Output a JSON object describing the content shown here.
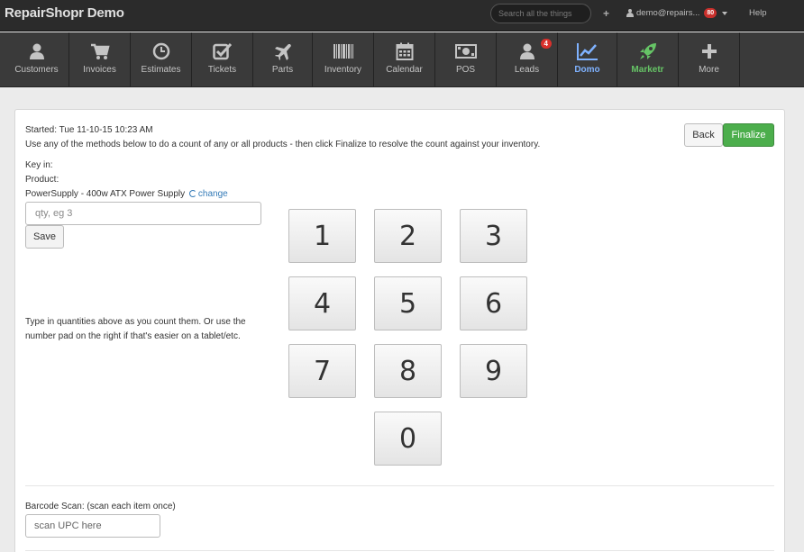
{
  "app": {
    "title": "RepairShopr Demo"
  },
  "header": {
    "search_placeholder": "Search all the things",
    "plus_label": "+",
    "user_label": "demo@repairs...",
    "user_badge": "80",
    "help_label": "Help"
  },
  "nav": {
    "items": [
      {
        "label": "Customers",
        "icon": "user-icon"
      },
      {
        "label": "Invoices",
        "icon": "cart-icon"
      },
      {
        "label": "Estimates",
        "icon": "clock-icon"
      },
      {
        "label": "Tickets",
        "icon": "checkbox-icon"
      },
      {
        "label": "Parts",
        "icon": "plane-icon"
      },
      {
        "label": "Inventory",
        "icon": "barcode-icon"
      },
      {
        "label": "Calendar",
        "icon": "calendar-icon"
      },
      {
        "label": "POS",
        "icon": "money-icon"
      },
      {
        "label": "Leads",
        "icon": "user-icon",
        "badge": "4"
      },
      {
        "label": "Domo",
        "icon": "chart-icon",
        "active": true
      },
      {
        "label": "Marketr",
        "icon": "rocket-icon"
      },
      {
        "label": "More",
        "icon": "plus-icon"
      }
    ],
    "active_color": "#7fb2ff",
    "marketr_color": "#66c466"
  },
  "count": {
    "started": "Started: Tue 11-10-15 10:23 AM",
    "instructions": "Use any of the methods below to do a count of any or all products - then click Finalize to resolve the count against your inventory.",
    "key_in_label": "Key in:",
    "product_label": "Product:",
    "product_name": "PowerSupply - 400w ATX Power Supply",
    "change_label": "change",
    "qty_placeholder": "qty, eg 3",
    "save_label": "Save",
    "help_text": "Type in quantities above as you count them. Or use the number pad on the right if that's easier on a tablet/etc.",
    "back_label": "Back",
    "finalize_label": "Finalize",
    "finalize_color": "#4cae4c",
    "keypad": [
      "1",
      "2",
      "3",
      "4",
      "5",
      "6",
      "7",
      "8",
      "9",
      "0"
    ],
    "barcode_label": "Barcode Scan: (scan each item once)",
    "upc_placeholder": "scan UPC here"
  }
}
